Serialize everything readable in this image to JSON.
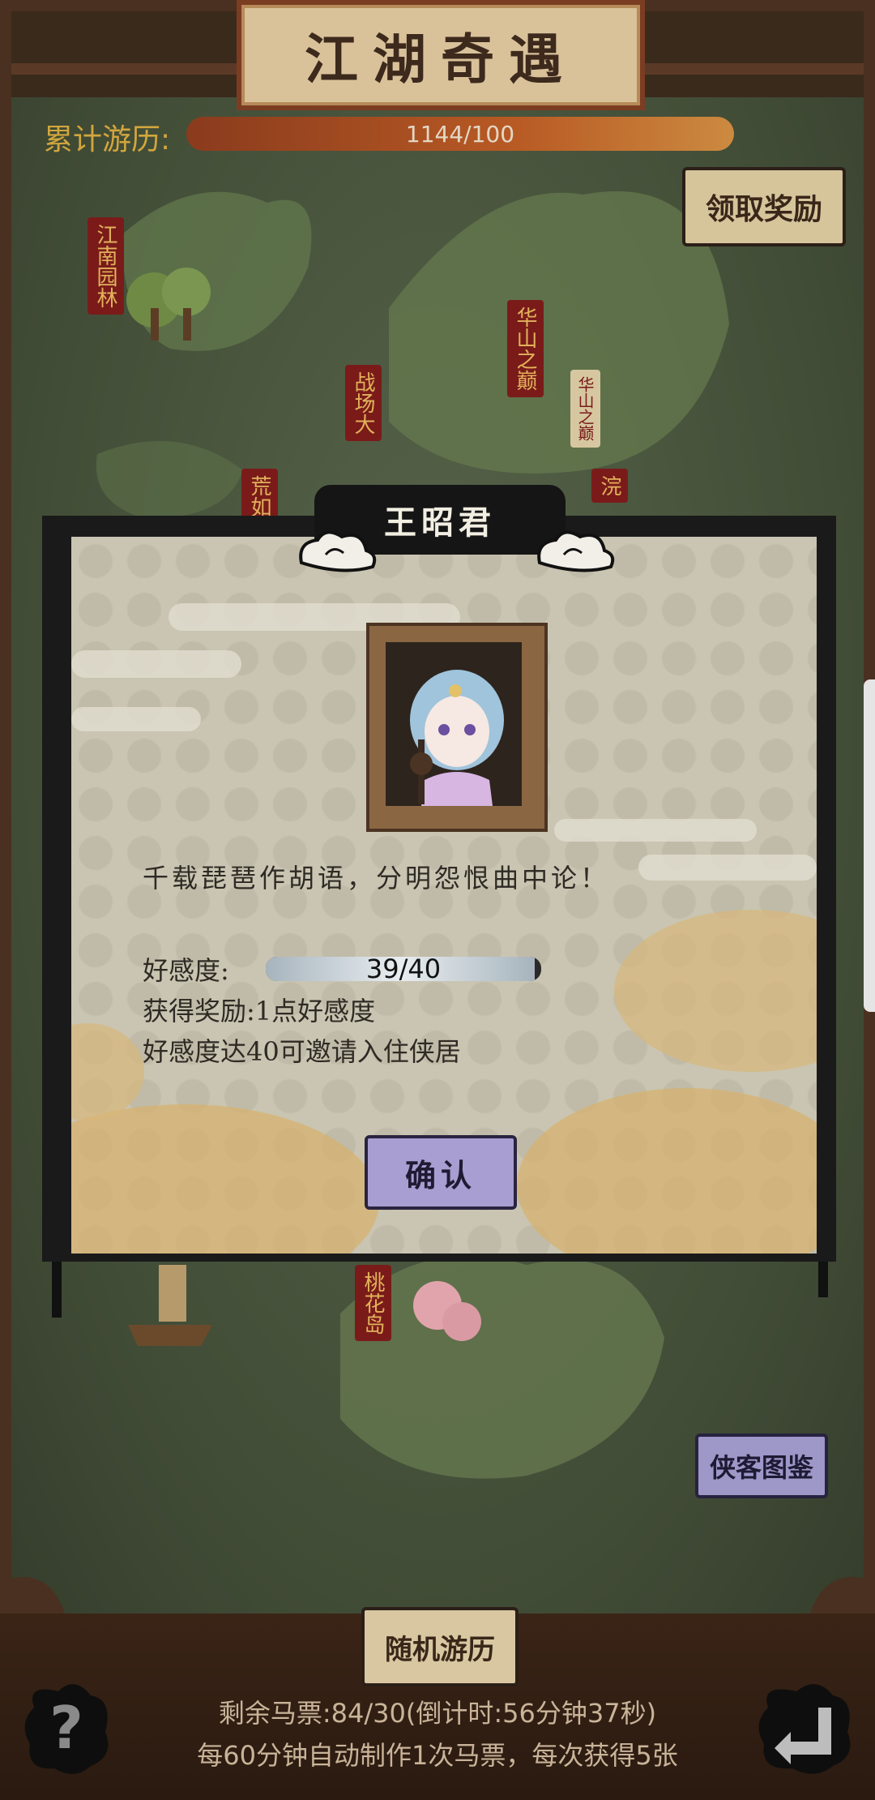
{
  "header": {
    "title": "江湖奇遇",
    "progress_label": "累计游历:",
    "progress_text": "1144/100",
    "progress_fraction": 1.0,
    "claim_button": "领取奖励"
  },
  "map": {
    "locations": [
      "江南园林",
      "华山之巅",
      "战场大",
      "荒如",
      "浣",
      "桃花岛"
    ],
    "sign_text": "华山之巅"
  },
  "dialog": {
    "character_name": "王昭君",
    "quote": "千载琵琶作胡语，分明怨恨曲中论！",
    "affection_label": "好感度:",
    "affection_text": "39/40",
    "affection_fraction": 0.975,
    "reward_line": "获得奖励:1点好感度",
    "invite_line": "好感度达40可邀请入住侠居",
    "confirm_button": "确认"
  },
  "gallery_button": "侠客图鉴",
  "footer": {
    "random_travel_button": "随机游历",
    "ticket_line": "剩余马票:84/30(倒计时:56分钟37秒)",
    "ticket_line2": "每60分钟自动制作1次马票，每次获得5张",
    "help_label": "?"
  },
  "colors": {
    "accent_gold": "#d2a63d",
    "banner_red": "#7a1b1a",
    "confirm_purple": "#a89ed1",
    "plaque_tan": "#d9c29a"
  }
}
